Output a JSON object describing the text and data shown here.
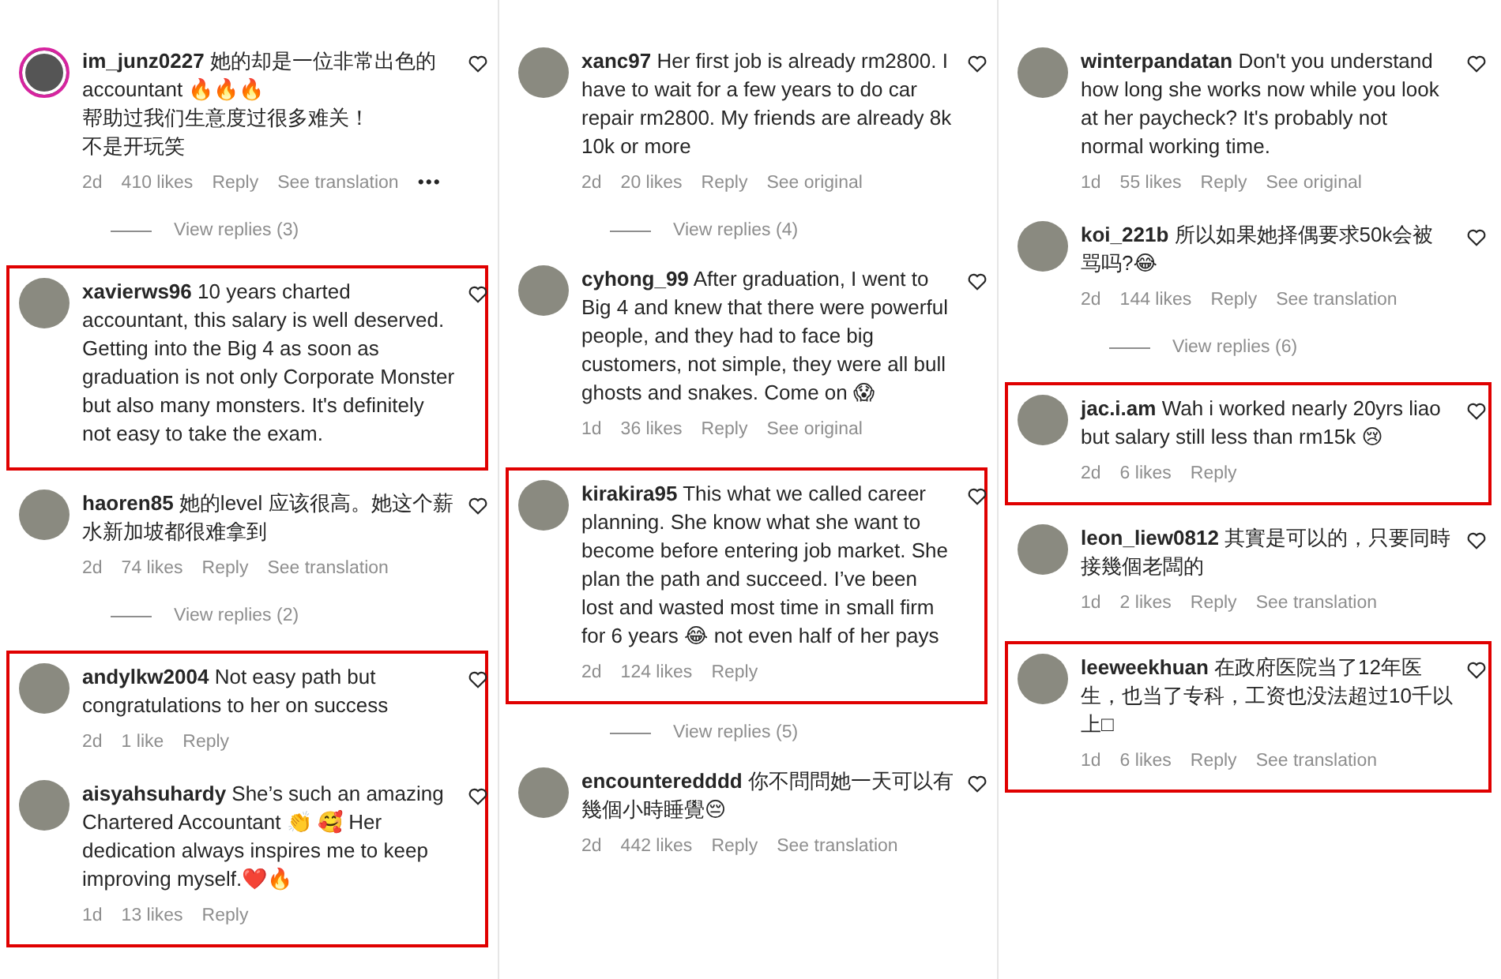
{
  "columns": [
    {
      "blocks": [
        {
          "highlighted": false,
          "items": [
            {
              "kind": "comment",
              "username": "im_junz0227",
              "story_ring": true,
              "text": "她的却是一位非常出色的accountant 🔥🔥🔥",
              "lines": [
                "帮助过我们生意度过很多难关！",
                "不是开玩笑"
              ],
              "time": "2d",
              "likes": "410 likes",
              "actions": [
                "Reply",
                "See translation"
              ],
              "more": "•••"
            },
            {
              "kind": "replies",
              "label": "View replies (3)"
            }
          ]
        },
        {
          "highlighted": true,
          "items": [
            {
              "kind": "comment",
              "username": "xavierws96",
              "story_ring": false,
              "text": "10 years charted accountant, this salary is well deserved. Getting into the Big 4 as soon as graduation is not only Corporate Monster but also many monsters. It's definitely not easy to take the exam."
            }
          ]
        },
        {
          "highlighted": false,
          "items": [
            {
              "kind": "comment",
              "username": "haoren85",
              "story_ring": false,
              "text": "她的level 应该很高。她这个薪水新加坡都很难拿到",
              "time": "2d",
              "likes": "74 likes",
              "actions": [
                "Reply",
                "See translation"
              ]
            },
            {
              "kind": "replies",
              "label": "View replies (2)"
            }
          ]
        },
        {
          "highlighted": true,
          "items": [
            {
              "kind": "comment",
              "username": "andylkw2004",
              "story_ring": false,
              "text": "Not easy path but congratulations to her on success",
              "time": "2d",
              "likes": "1 like",
              "actions": [
                "Reply"
              ]
            },
            {
              "kind": "comment",
              "username": "aisyahsuhardy",
              "story_ring": false,
              "text": "She’s such an amazing Chartered Accountant 👏 🥰 Her dedication always inspires me to keep improving myself.❤️🔥",
              "time": "1d",
              "likes": "13 likes",
              "actions": [
                "Reply"
              ]
            }
          ]
        }
      ]
    },
    {
      "blocks": [
        {
          "highlighted": false,
          "items": [
            {
              "kind": "comment",
              "username": "xanc97",
              "story_ring": false,
              "text": "Her first job is already rm2800. I have to wait for a few years to do car repair rm2800. My friends are already 8k 10k or more",
              "time": "2d",
              "likes": "20 likes",
              "actions": [
                "Reply",
                "See original"
              ]
            },
            {
              "kind": "replies",
              "label": "View replies (4)"
            },
            {
              "kind": "comment",
              "username": "cyhong_99",
              "story_ring": false,
              "text": "After graduation, I went to Big 4 and knew that there were powerful people, and they had to face big customers, not simple, they were all bull ghosts and snakes. Come on 😱",
              "time": "1d",
              "likes": "36 likes",
              "actions": [
                "Reply",
                "See original"
              ]
            }
          ]
        },
        {
          "highlighted": true,
          "items": [
            {
              "kind": "comment",
              "username": "kirakira95",
              "story_ring": false,
              "text": "This what we called career planning. She know what she want to become before entering job market. She plan the path and succeed. I’ve been lost and wasted most time in small firm for 6 years 😂 not even half of her pays",
              "time": "2d",
              "likes": "124 likes",
              "actions": [
                "Reply"
              ]
            }
          ]
        },
        {
          "highlighted": false,
          "items": [
            {
              "kind": "replies",
              "label": "View replies (5)"
            },
            {
              "kind": "comment",
              "username": "encounteredddd",
              "story_ring": false,
              "text": "你不問問她一天可以有幾個小時睡覺😔",
              "time": "2d",
              "likes": "442 likes",
              "actions": [
                "Reply",
                "See translation"
              ]
            }
          ]
        }
      ]
    },
    {
      "blocks": [
        {
          "highlighted": false,
          "items": [
            {
              "kind": "comment",
              "username": "winterpandatan",
              "story_ring": false,
              "text": "Don't you understand how long she works now while you look at her paycheck? It's probably not normal working time.",
              "time": "1d",
              "likes": "55 likes",
              "actions": [
                "Reply",
                "See original"
              ]
            },
            {
              "kind": "comment",
              "username": "koi_221b",
              "story_ring": false,
              "text": "所以如果她择偶要求50k会被骂吗?😂",
              "time": "2d",
              "likes": "144 likes",
              "actions": [
                "Reply",
                "See translation"
              ]
            },
            {
              "kind": "replies",
              "label": "View replies (6)"
            }
          ]
        },
        {
          "highlighted": true,
          "items": [
            {
              "kind": "comment",
              "username": "jac.i.am",
              "story_ring": false,
              "text": "Wah i worked nearly 20yrs liao but salary still less than rm15k 😢",
              "time": "2d",
              "likes": "6 likes",
              "actions": [
                "Reply"
              ]
            }
          ]
        },
        {
          "highlighted": false,
          "items": [
            {
              "kind": "comment",
              "username": "leon_liew0812",
              "story_ring": false,
              "text": "其實是可以的，只要同時接幾個老闆的",
              "time": "1d",
              "likes": "2 likes",
              "actions": [
                "Reply",
                "See translation"
              ]
            }
          ]
        },
        {
          "highlighted": true,
          "items": [
            {
              "kind": "comment",
              "username": "leeweekhuan",
              "story_ring": false,
              "text": "在政府医院当了12年医生，也当了专科，工资也没法超过10千以上□",
              "time": "1d",
              "likes": "6 likes",
              "actions": [
                "Reply",
                "See translation"
              ]
            }
          ]
        }
      ]
    }
  ]
}
